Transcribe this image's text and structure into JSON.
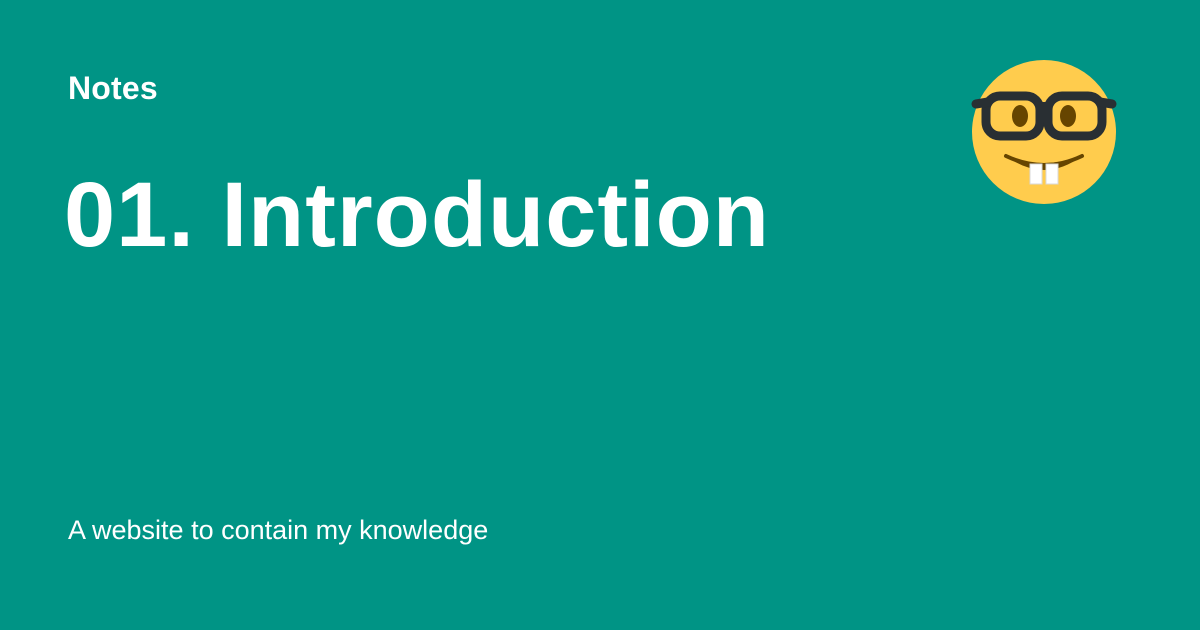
{
  "card": {
    "background_color": "#009485",
    "text_color": "#FFFFFF",
    "site_name": "Notes",
    "title": "01. Introduction",
    "description": "A website to contain my knowledge",
    "logo_icon": "nerd-face-emoji-icon"
  }
}
